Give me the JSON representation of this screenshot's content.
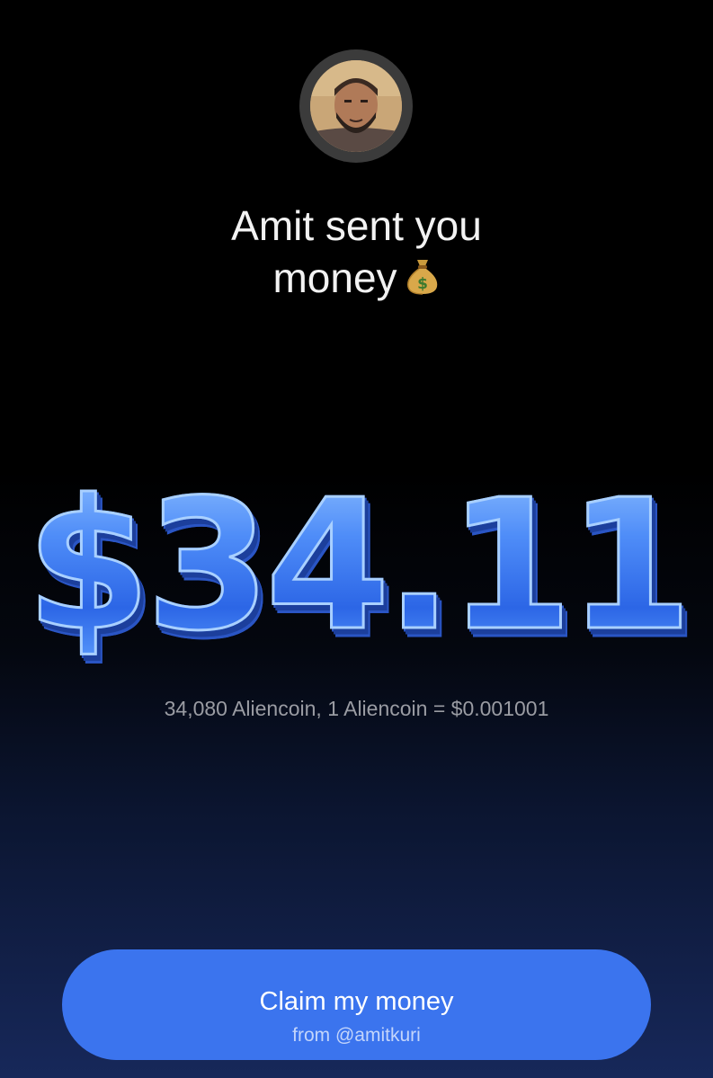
{
  "sender": {
    "avatar_icon": "user-avatar-photo",
    "headline_line1": "Amit sent you",
    "headline_line2": "money",
    "headline_emoji_icon": "money-bag-icon"
  },
  "transfer": {
    "amount": "$34.11",
    "conversion": "34,080 Aliencoin, 1 Aliencoin = $0.001001"
  },
  "claim_button": {
    "label": "Claim my money",
    "sublabel": "from @amitkuri"
  },
  "colors": {
    "accent": "#3b74ee",
    "amount_blue": "#3f7df5",
    "background_top": "#000000",
    "background_bottom": "#17285a"
  }
}
